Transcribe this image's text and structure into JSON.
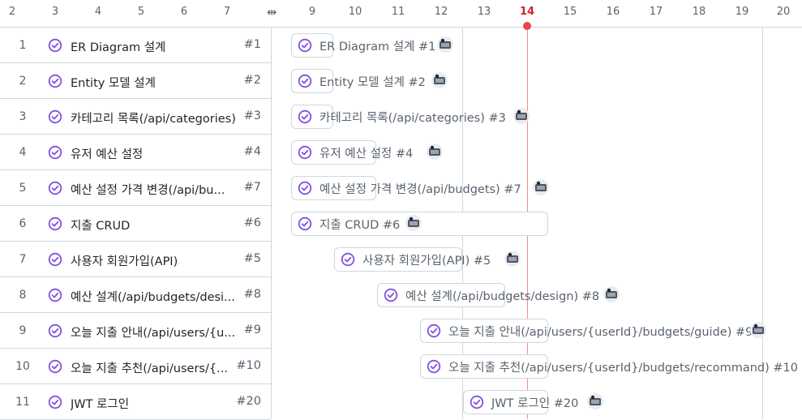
{
  "timeline": {
    "days": [
      "2",
      "3",
      "4",
      "5",
      "6",
      "7",
      "9",
      "10",
      "11",
      "12",
      "13",
      "14",
      "15",
      "16",
      "17",
      "18",
      "19",
      "20"
    ],
    "today": "14"
  },
  "colors": {
    "accent": "#8250df",
    "today": "#cf222e",
    "border": "#d0d7de",
    "muted": "#59636e"
  },
  "rows": [
    {
      "num": "1",
      "title": "ER Diagram 설계",
      "ref": "#1",
      "bar_label": "ER Diagram 설계 #1"
    },
    {
      "num": "2",
      "title": "Entity 모델 설계",
      "ref": "#2",
      "bar_label": "Entity 모델 설계 #2"
    },
    {
      "num": "3",
      "title": "카테고리 목록(/api/categories)",
      "ref": "#3",
      "bar_label": "카테고리 목록(/api/categories) #3"
    },
    {
      "num": "4",
      "title": "유저 예산 설정",
      "ref": "#4",
      "bar_label": "유저 예산 설정 #4"
    },
    {
      "num": "5",
      "title": "예산 설정 가격 변경(/api/bu...",
      "ref": "#7",
      "bar_label": "예산 설정 가격 변경(/api/budgets) #7"
    },
    {
      "num": "6",
      "title": "지출 CRUD",
      "ref": "#6",
      "bar_label": "지출 CRUD #6"
    },
    {
      "num": "7",
      "title": "사용자 회원가입(API)",
      "ref": "#5",
      "bar_label": "사용자 회원가입(API) #5"
    },
    {
      "num": "8",
      "title": "예산 설계(/api/budgets/desi...",
      "ref": "#8",
      "bar_label": "예산 설계(/api/budgets/design) #8"
    },
    {
      "num": "9",
      "title": "오늘 지출 안내(/api/users/{u...",
      "ref": "#9",
      "bar_label": "오늘 지출 안내(/api/users/{userId}/budgets/guide) #9"
    },
    {
      "num": "10",
      "title": "오늘 지출 추천(/api/users/{...",
      "ref": "#10",
      "bar_label": "오늘 지출 추천(/api/users/{userId}/budgets/recommand) #10"
    },
    {
      "num": "11",
      "title": "JWT 로그인",
      "ref": "#20",
      "bar_label": "JWT 로그인 #20"
    }
  ],
  "icons": {
    "row_status": "circle-check-icon",
    "resize": "resize-handle-icon",
    "assignee": "avatar"
  }
}
